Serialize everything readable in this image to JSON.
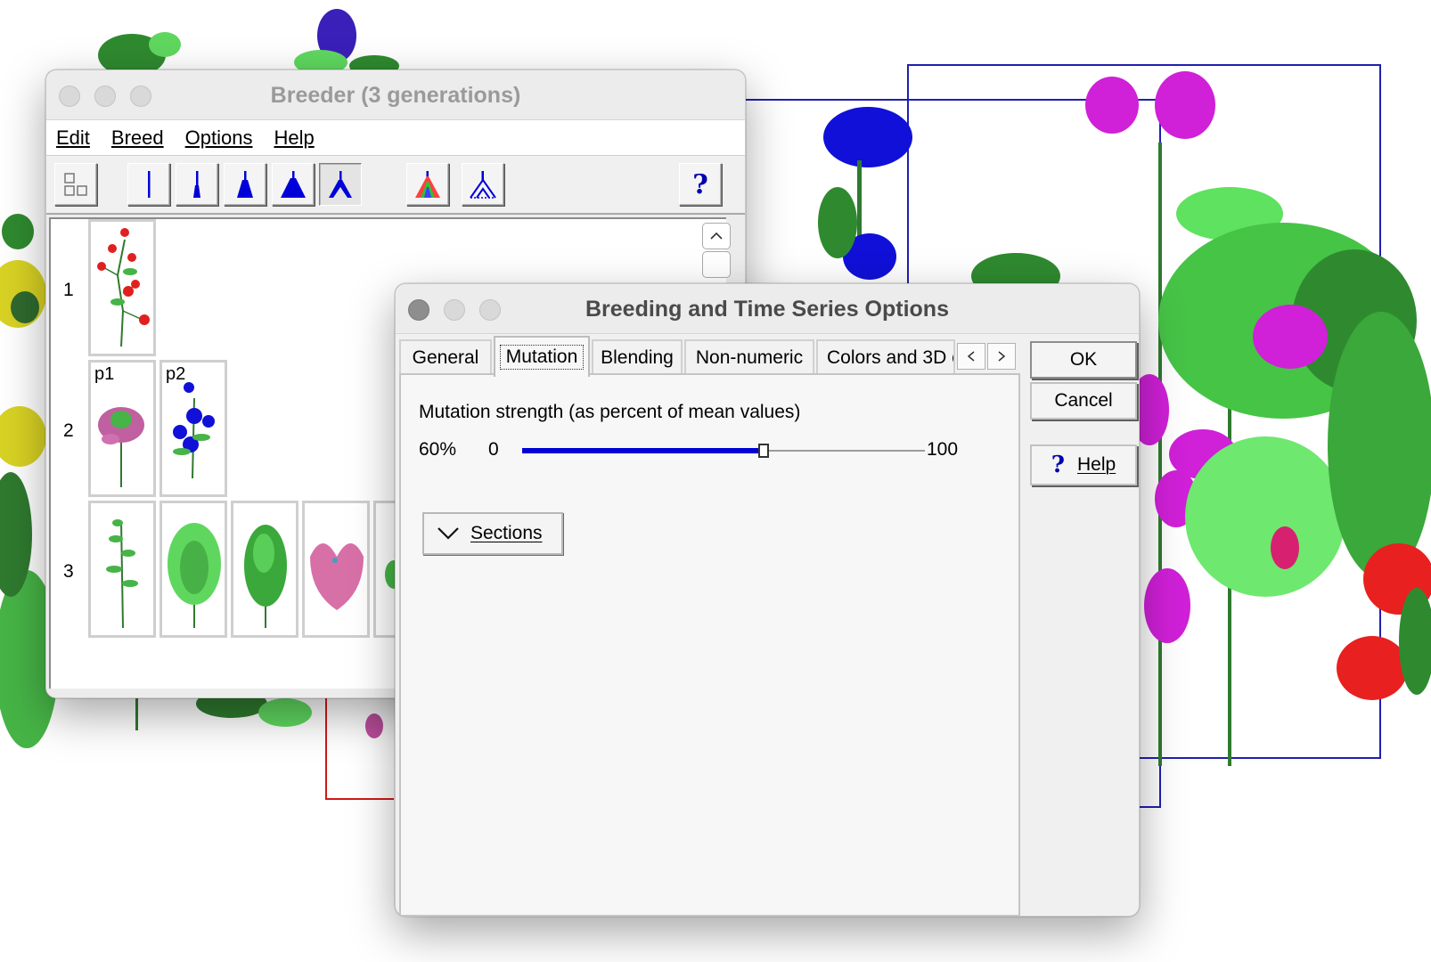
{
  "breeder": {
    "title": "Breeder (3 generations)",
    "menu": [
      {
        "label": "Edit"
      },
      {
        "label": "Breed"
      },
      {
        "label": "Options"
      },
      {
        "label": "Help"
      }
    ],
    "toolbar": {
      "icons": [
        "generations-view-icon",
        "variation-none-icon",
        "variation-low-icon",
        "variation-medium-icon",
        "variation-high-icon",
        "variation-custom-icon",
        "colored-tree-icon",
        "tree-outline-icon",
        "help-icon"
      ],
      "help_label": "?",
      "pressed": "variation-custom-icon"
    },
    "rows": [
      {
        "label": "1",
        "plants": [
          {
            "name": "",
            "kind": "red-flower"
          }
        ]
      },
      {
        "label": "2",
        "plants": [
          {
            "name": "p1",
            "kind": "pink-sprig"
          },
          {
            "name": "p2",
            "kind": "blue-flower"
          }
        ]
      },
      {
        "label": "3",
        "plants": [
          {
            "name": "",
            "kind": "green-sprig"
          },
          {
            "name": "",
            "kind": "green-bush"
          },
          {
            "name": "",
            "kind": "green-tree"
          },
          {
            "name": "",
            "kind": "pink-blob"
          }
        ]
      }
    ]
  },
  "dialog": {
    "title": "Breeding and Time Series Options",
    "tabs": [
      {
        "label": "General"
      },
      {
        "label": "Mutation"
      },
      {
        "label": "Blending"
      },
      {
        "label": "Non-numeric"
      },
      {
        "label": "Colors and 3D o"
      }
    ],
    "active_tab": "Mutation",
    "mutation": {
      "label": "Mutation strength (as percent of mean values)",
      "value_text": "60%",
      "value": 60,
      "min_label": "0",
      "max_label": "100"
    },
    "sections_label": "Sections",
    "buttons": {
      "ok": "OK",
      "cancel": "Cancel",
      "help": "Help",
      "help_icon": "?"
    },
    "colors": {
      "accent": "#0000d8"
    }
  }
}
